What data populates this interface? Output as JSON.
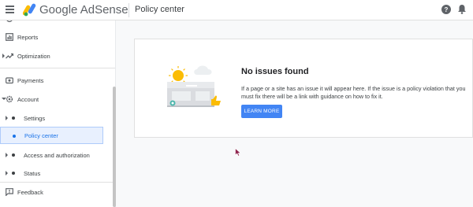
{
  "topbar": {
    "brand_google": "Google",
    "brand_product": "AdSense",
    "page_title": "Policy center",
    "menu_icon": "menu-icon",
    "help_icon": "help-icon",
    "notifications_icon": "bell-icon"
  },
  "sidebar": {
    "items": [
      {
        "label": "Reports",
        "icon": "reports-icon"
      },
      {
        "label": "Optimization",
        "icon": "trending-up-icon"
      },
      {
        "label": "Payments",
        "icon": "payments-icon"
      },
      {
        "label": "Account",
        "icon": "gear-icon"
      },
      {
        "label": "Settings"
      },
      {
        "label": "Policy center"
      },
      {
        "label": "Access and authorization"
      },
      {
        "label": "Status"
      },
      {
        "label": "Feedback",
        "icon": "feedback-icon"
      }
    ]
  },
  "card": {
    "heading": "No issues found",
    "body": "If a page or a site has an issue it will appear here. If the issue is a policy violation that you must fix there will be a link with guidance on how to fix it.",
    "button_label": "LEARN MORE"
  },
  "colors": {
    "accent": "#4285f4",
    "active_bg": "#e8f0fe",
    "active_text": "#1a73e8",
    "background": "#f8f9fa"
  }
}
